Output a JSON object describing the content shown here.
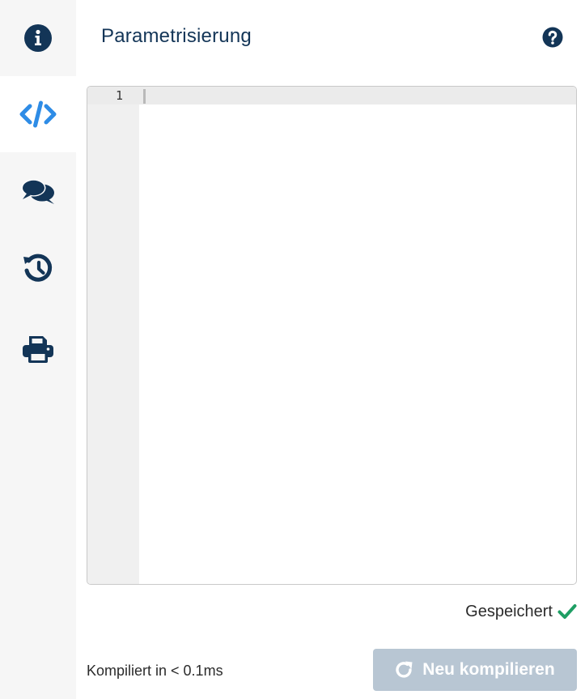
{
  "sidebar": {
    "items": [
      {
        "name": "info",
        "icon": "info-circle-icon",
        "active": false
      },
      {
        "name": "code",
        "icon": "code-icon",
        "active": true
      },
      {
        "name": "comments",
        "icon": "comments-icon",
        "active": false
      },
      {
        "name": "history",
        "icon": "history-icon",
        "active": false
      },
      {
        "name": "print",
        "icon": "print-icon",
        "active": false
      }
    ]
  },
  "header": {
    "title": "Parametrisierung",
    "help_icon": "question-circle-icon"
  },
  "editor": {
    "line_numbers": [
      "1"
    ],
    "content": ""
  },
  "status": {
    "saved_text": "Gespeichert",
    "saved_icon": "check-icon"
  },
  "footer": {
    "compile_info": "Kompiliert in < 0.1ms",
    "recompile_label": "Neu kompilieren",
    "recompile_icon": "redo-icon"
  },
  "colors": {
    "primary_dark": "#133557",
    "accent_blue": "#2e8ce6",
    "success_green": "#1e9e64",
    "disabled_button": "#b8c6d3",
    "sidebar_bg": "#f6f6f6"
  }
}
